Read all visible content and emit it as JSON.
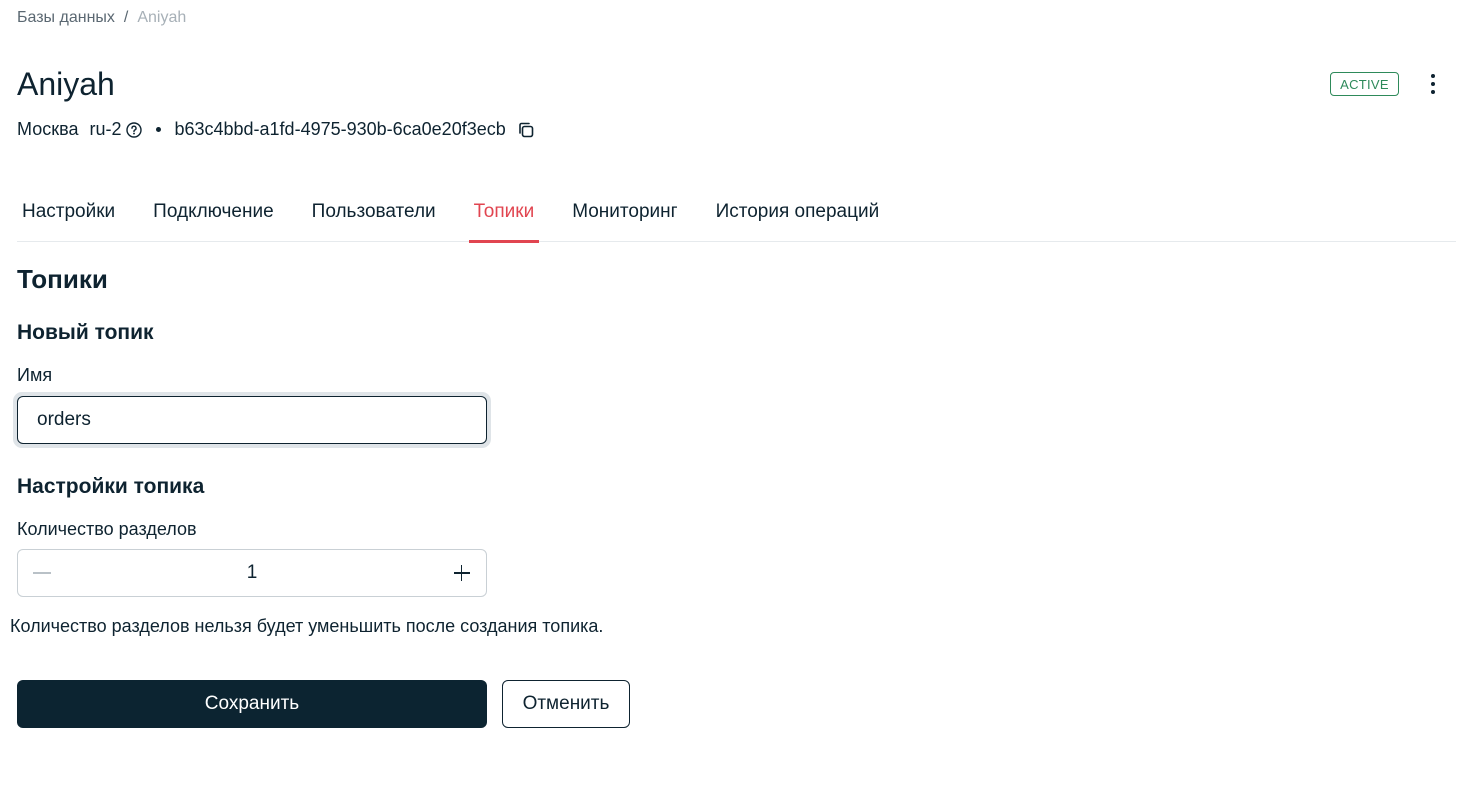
{
  "breadcrumb": {
    "items": [
      "Базы данных",
      "Aniyah"
    ],
    "separator": "/"
  },
  "header": {
    "title": "Aniyah",
    "city": "Москва",
    "region": "ru-2",
    "cluster_id": "b63c4bbd-a1fd-4975-930b-6ca0e20f3ecb",
    "status": "ACTIVE"
  },
  "tabs": [
    {
      "label": "Настройки",
      "active": false
    },
    {
      "label": "Подключение",
      "active": false
    },
    {
      "label": "Пользователи",
      "active": false
    },
    {
      "label": "Топики",
      "active": true
    },
    {
      "label": "Мониторинг",
      "active": false
    },
    {
      "label": "История операций",
      "active": false
    }
  ],
  "content": {
    "section_title": "Топики",
    "new_topic_title": "Новый топик",
    "name_label": "Имя",
    "name_value": "orders",
    "settings_title": "Настройки топика",
    "partitions_label": "Количество разделов",
    "partitions_value": "1",
    "partitions_hint": "Количество разделов нельзя будет уменьшить после создания топика."
  },
  "actions": {
    "save_label": "Сохранить",
    "cancel_label": "Отменить"
  },
  "colors": {
    "accent": "#e14550",
    "primary": "#0c2431",
    "status_active": "#2e8a5a"
  }
}
